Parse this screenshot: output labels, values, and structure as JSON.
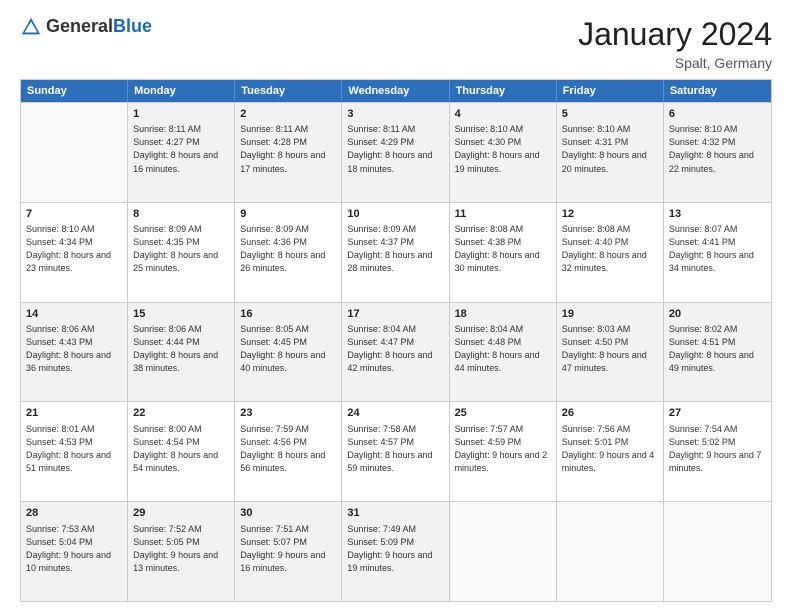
{
  "header": {
    "logo_general": "General",
    "logo_blue": "Blue",
    "month_title": "January 2024",
    "location": "Spalt, Germany"
  },
  "calendar": {
    "days_of_week": [
      "Sunday",
      "Monday",
      "Tuesday",
      "Wednesday",
      "Thursday",
      "Friday",
      "Saturday"
    ],
    "weeks": [
      [
        {
          "day": "",
          "sunrise": "",
          "sunset": "",
          "daylight": "",
          "empty": true
        },
        {
          "day": "1",
          "sunrise": "Sunrise: 8:11 AM",
          "sunset": "Sunset: 4:27 PM",
          "daylight": "Daylight: 8 hours and 16 minutes.",
          "empty": false
        },
        {
          "day": "2",
          "sunrise": "Sunrise: 8:11 AM",
          "sunset": "Sunset: 4:28 PM",
          "daylight": "Daylight: 8 hours and 17 minutes.",
          "empty": false
        },
        {
          "day": "3",
          "sunrise": "Sunrise: 8:11 AM",
          "sunset": "Sunset: 4:29 PM",
          "daylight": "Daylight: 8 hours and 18 minutes.",
          "empty": false
        },
        {
          "day": "4",
          "sunrise": "Sunrise: 8:10 AM",
          "sunset": "Sunset: 4:30 PM",
          "daylight": "Daylight: 8 hours and 19 minutes.",
          "empty": false
        },
        {
          "day": "5",
          "sunrise": "Sunrise: 8:10 AM",
          "sunset": "Sunset: 4:31 PM",
          "daylight": "Daylight: 8 hours and 20 minutes.",
          "empty": false
        },
        {
          "day": "6",
          "sunrise": "Sunrise: 8:10 AM",
          "sunset": "Sunset: 4:32 PM",
          "daylight": "Daylight: 8 hours and 22 minutes.",
          "empty": false
        }
      ],
      [
        {
          "day": "7",
          "sunrise": "Sunrise: 8:10 AM",
          "sunset": "Sunset: 4:34 PM",
          "daylight": "Daylight: 8 hours and 23 minutes.",
          "empty": false
        },
        {
          "day": "8",
          "sunrise": "Sunrise: 8:09 AM",
          "sunset": "Sunset: 4:35 PM",
          "daylight": "Daylight: 8 hours and 25 minutes.",
          "empty": false
        },
        {
          "day": "9",
          "sunrise": "Sunrise: 8:09 AM",
          "sunset": "Sunset: 4:36 PM",
          "daylight": "Daylight: 8 hours and 26 minutes.",
          "empty": false
        },
        {
          "day": "10",
          "sunrise": "Sunrise: 8:09 AM",
          "sunset": "Sunset: 4:37 PM",
          "daylight": "Daylight: 8 hours and 28 minutes.",
          "empty": false
        },
        {
          "day": "11",
          "sunrise": "Sunrise: 8:08 AM",
          "sunset": "Sunset: 4:38 PM",
          "daylight": "Daylight: 8 hours and 30 minutes.",
          "empty": false
        },
        {
          "day": "12",
          "sunrise": "Sunrise: 8:08 AM",
          "sunset": "Sunset: 4:40 PM",
          "daylight": "Daylight: 8 hours and 32 minutes.",
          "empty": false
        },
        {
          "day": "13",
          "sunrise": "Sunrise: 8:07 AM",
          "sunset": "Sunset: 4:41 PM",
          "daylight": "Daylight: 8 hours and 34 minutes.",
          "empty": false
        }
      ],
      [
        {
          "day": "14",
          "sunrise": "Sunrise: 8:06 AM",
          "sunset": "Sunset: 4:43 PM",
          "daylight": "Daylight: 8 hours and 36 minutes.",
          "empty": false
        },
        {
          "day": "15",
          "sunrise": "Sunrise: 8:06 AM",
          "sunset": "Sunset: 4:44 PM",
          "daylight": "Daylight: 8 hours and 38 minutes.",
          "empty": false
        },
        {
          "day": "16",
          "sunrise": "Sunrise: 8:05 AM",
          "sunset": "Sunset: 4:45 PM",
          "daylight": "Daylight: 8 hours and 40 minutes.",
          "empty": false
        },
        {
          "day": "17",
          "sunrise": "Sunrise: 8:04 AM",
          "sunset": "Sunset: 4:47 PM",
          "daylight": "Daylight: 8 hours and 42 minutes.",
          "empty": false
        },
        {
          "day": "18",
          "sunrise": "Sunrise: 8:04 AM",
          "sunset": "Sunset: 4:48 PM",
          "daylight": "Daylight: 8 hours and 44 minutes.",
          "empty": false
        },
        {
          "day": "19",
          "sunrise": "Sunrise: 8:03 AM",
          "sunset": "Sunset: 4:50 PM",
          "daylight": "Daylight: 8 hours and 47 minutes.",
          "empty": false
        },
        {
          "day": "20",
          "sunrise": "Sunrise: 8:02 AM",
          "sunset": "Sunset: 4:51 PM",
          "daylight": "Daylight: 8 hours and 49 minutes.",
          "empty": false
        }
      ],
      [
        {
          "day": "21",
          "sunrise": "Sunrise: 8:01 AM",
          "sunset": "Sunset: 4:53 PM",
          "daylight": "Daylight: 8 hours and 51 minutes.",
          "empty": false
        },
        {
          "day": "22",
          "sunrise": "Sunrise: 8:00 AM",
          "sunset": "Sunset: 4:54 PM",
          "daylight": "Daylight: 8 hours and 54 minutes.",
          "empty": false
        },
        {
          "day": "23",
          "sunrise": "Sunrise: 7:59 AM",
          "sunset": "Sunset: 4:56 PM",
          "daylight": "Daylight: 8 hours and 56 minutes.",
          "empty": false
        },
        {
          "day": "24",
          "sunrise": "Sunrise: 7:58 AM",
          "sunset": "Sunset: 4:57 PM",
          "daylight": "Daylight: 8 hours and 59 minutes.",
          "empty": false
        },
        {
          "day": "25",
          "sunrise": "Sunrise: 7:57 AM",
          "sunset": "Sunset: 4:59 PM",
          "daylight": "Daylight: 9 hours and 2 minutes.",
          "empty": false
        },
        {
          "day": "26",
          "sunrise": "Sunrise: 7:56 AM",
          "sunset": "Sunset: 5:01 PM",
          "daylight": "Daylight: 9 hours and 4 minutes.",
          "empty": false
        },
        {
          "day": "27",
          "sunrise": "Sunrise: 7:54 AM",
          "sunset": "Sunset: 5:02 PM",
          "daylight": "Daylight: 9 hours and 7 minutes.",
          "empty": false
        }
      ],
      [
        {
          "day": "28",
          "sunrise": "Sunrise: 7:53 AM",
          "sunset": "Sunset: 5:04 PM",
          "daylight": "Daylight: 9 hours and 10 minutes.",
          "empty": false
        },
        {
          "day": "29",
          "sunrise": "Sunrise: 7:52 AM",
          "sunset": "Sunset: 5:05 PM",
          "daylight": "Daylight: 9 hours and 13 minutes.",
          "empty": false
        },
        {
          "day": "30",
          "sunrise": "Sunrise: 7:51 AM",
          "sunset": "Sunset: 5:07 PM",
          "daylight": "Daylight: 9 hours and 16 minutes.",
          "empty": false
        },
        {
          "day": "31",
          "sunrise": "Sunrise: 7:49 AM",
          "sunset": "Sunset: 5:09 PM",
          "daylight": "Daylight: 9 hours and 19 minutes.",
          "empty": false
        },
        {
          "day": "",
          "sunrise": "",
          "sunset": "",
          "daylight": "",
          "empty": true
        },
        {
          "day": "",
          "sunrise": "",
          "sunset": "",
          "daylight": "",
          "empty": true
        },
        {
          "day": "",
          "sunrise": "",
          "sunset": "",
          "daylight": "",
          "empty": true
        }
      ]
    ]
  }
}
